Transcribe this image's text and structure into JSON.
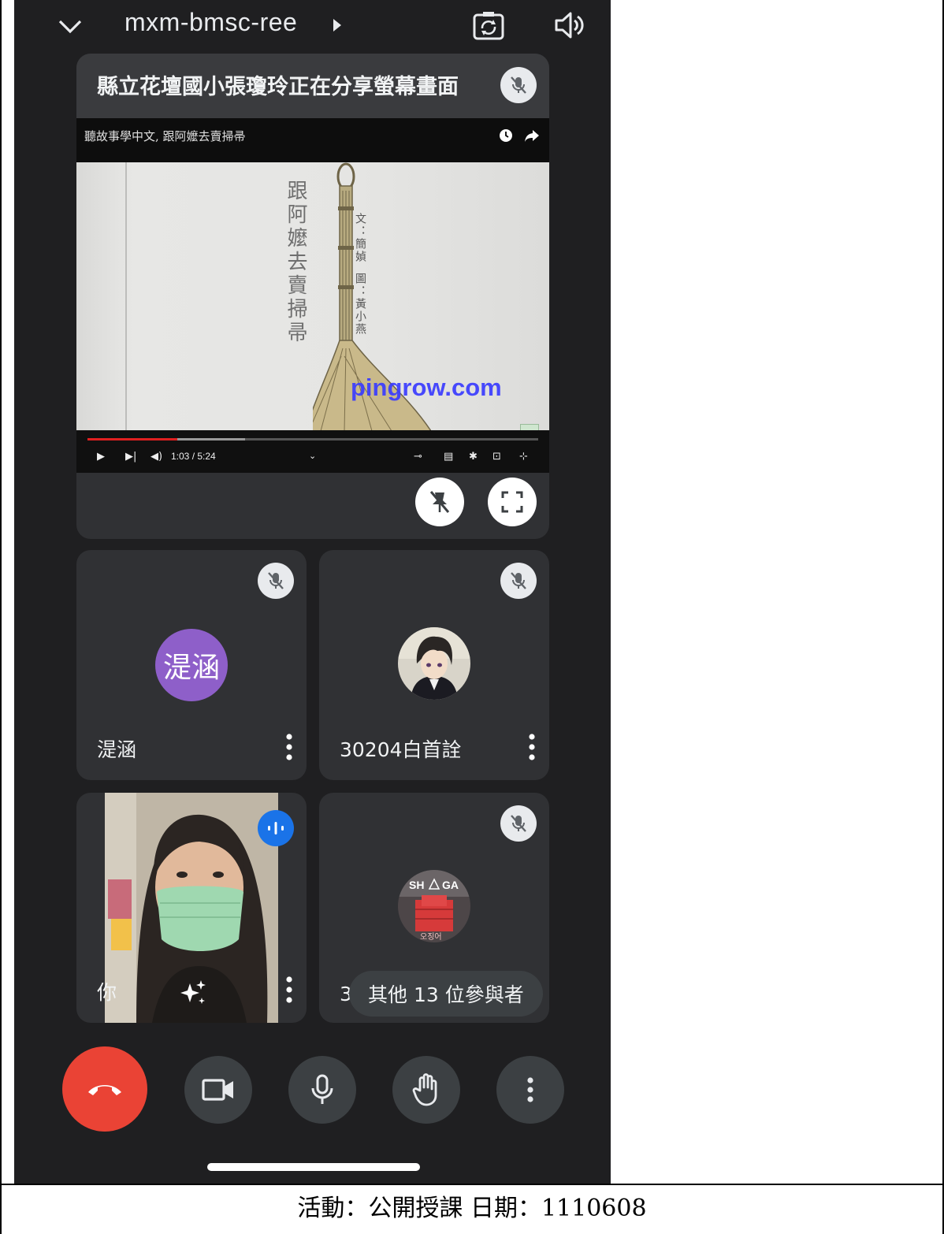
{
  "meeting": {
    "code": "mxm-bmsc-ree"
  },
  "presentation": {
    "title": "縣立花壇國小張瓊玲正在分享螢幕畫面",
    "video_title": "聽故事學中文, 跟阿嬤去賣掃帚",
    "book_title": "跟阿嬤去賣掃帚",
    "author_line": "文：簡媜",
    "illustrator_line": "圖：黃小燕",
    "watermark": "pingrow.com",
    "time": "1:03 / 5:24",
    "progress": 0.2
  },
  "participants": [
    {
      "name": "湜涵",
      "avatar_text": "湜涵",
      "avatar_color": "#8e5fc9",
      "muted": true
    },
    {
      "name": "30204白首詮",
      "avatar": "anime-boy-avatar",
      "muted": true
    },
    {
      "name": "你",
      "video": "self-camera",
      "speaking": true
    },
    {
      "name": "3",
      "avatar": "squid-game-avatar",
      "muted": true
    }
  ],
  "others_label": "其他 13 位參與者",
  "caption": "活動：公開授課 日期：1110608",
  "colors": {
    "background": "#1f1f21",
    "tile": "#303134",
    "end_call": "#ea4335",
    "speaking": "#1a73e8",
    "avatar_purple": "#8e5fc9"
  }
}
